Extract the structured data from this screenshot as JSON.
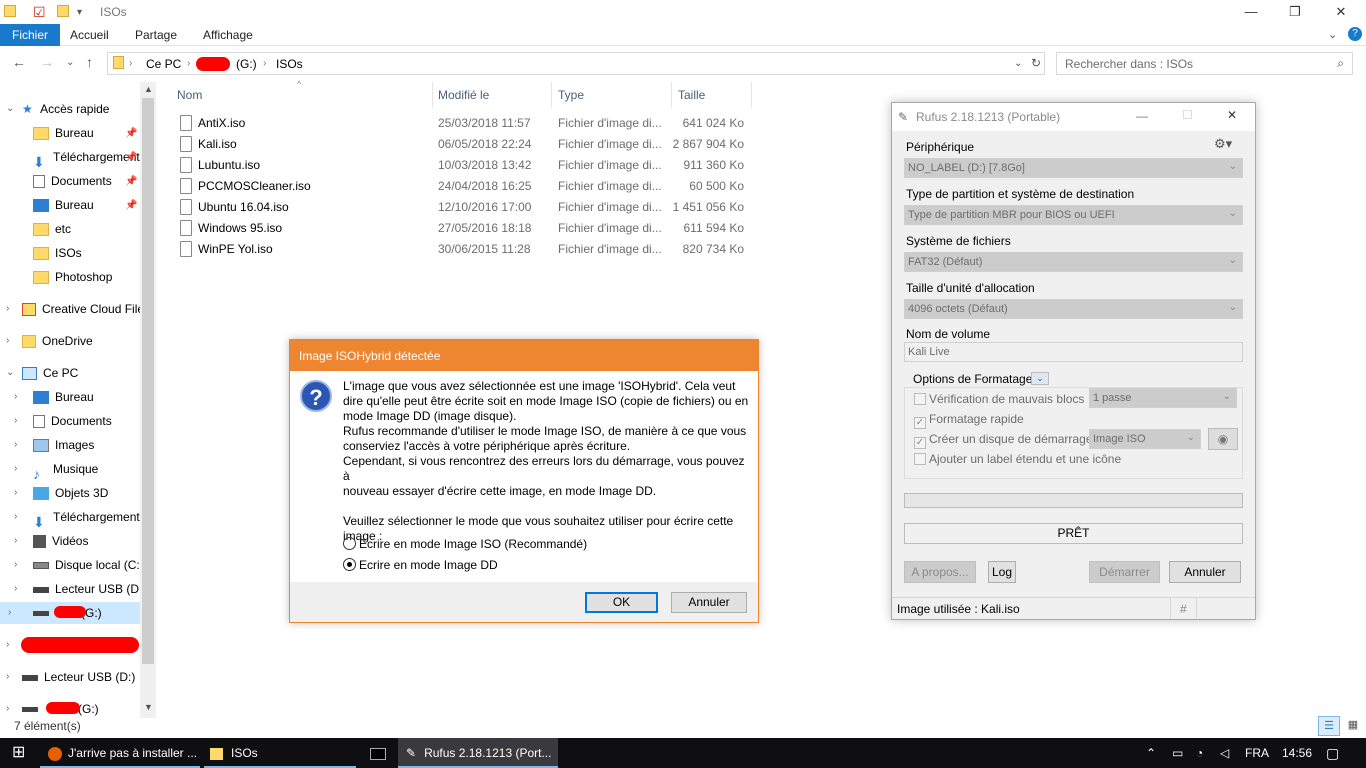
{
  "explorer": {
    "title": "ISOs",
    "ribbon_tabs": [
      "Fichier",
      "Accueil",
      "Partage",
      "Affichage"
    ],
    "breadcrumb": {
      "this_pc": "Ce PC",
      "drive": "(G:)",
      "folder": "ISOs"
    },
    "search_placeholder": "Rechercher dans : ISOs",
    "columns": {
      "name": "Nom",
      "modified": "Modifié le",
      "type": "Type",
      "size": "Taille"
    },
    "files": [
      {
        "name": "AntiX.iso",
        "modified": "25/03/2018 11:57",
        "type": "Fichier d'image di...",
        "size": "641 024 Ko"
      },
      {
        "name": "Kali.iso",
        "modified": "06/05/2018 22:24",
        "type": "Fichier d'image di...",
        "size": "2 867 904 Ko"
      },
      {
        "name": "Lubuntu.iso",
        "modified": "10/03/2018 13:42",
        "type": "Fichier d'image di...",
        "size": "911 360 Ko"
      },
      {
        "name": "PCCMOSCleaner.iso",
        "modified": "24/04/2018 16:25",
        "type": "Fichier d'image di...",
        "size": "60 500 Ko"
      },
      {
        "name": "Ubuntu 16.04.iso",
        "modified": "12/10/2016 17:00",
        "type": "Fichier d'image di...",
        "size": "1 451 056 Ko"
      },
      {
        "name": "Windows 95.iso",
        "modified": "27/05/2016 18:18",
        "type": "Fichier d'image di...",
        "size": "611 594 Ko"
      },
      {
        "name": "WinPE Yol.iso",
        "modified": "30/06/2015 11:28",
        "type": "Fichier d'image di...",
        "size": "820 734 Ko"
      }
    ],
    "nav": {
      "quick_access": "Accès rapide",
      "quick_items": [
        "Bureau",
        "Téléchargements",
        "Documents",
        "Bureau",
        "etc",
        "ISOs",
        "Photoshop"
      ],
      "creative_cloud": "Creative Cloud Files",
      "onedrive": "OneDrive",
      "this_pc": "Ce PC",
      "pc_items": [
        "Bureau",
        "Documents",
        "Images",
        "Musique",
        "Objets 3D",
        "Téléchargements",
        "Vidéos",
        "Disque local (C:)",
        "Lecteur USB (D:)",
        "(G:)"
      ],
      "usb_d": "Lecteur USB (D:)",
      "g_drive": "(G:)"
    },
    "status": "7 élément(s)"
  },
  "dialog": {
    "title": "Image ISOHybrid détectée",
    "message_lines": [
      "L'image que vous avez sélectionnée est une image 'ISOHybrid'. Cela veut",
      "dire qu'elle peut être écrite soit en mode Image ISO (copie de fichiers) ou en",
      "mode Image DD (image disque).",
      "Rufus recommande d'utiliser le mode Image ISO, de manière à ce que vous",
      "conserviez l'accès à votre périphérique après écriture.",
      "Cependant, si vous rencontrez des erreurs lors du démarrage, vous pouvez à",
      "nouveau essayer d'écrire cette image, en mode Image DD.",
      "",
      "Veuillez sélectionner le mode que vous souhaitez utiliser pour écrire cette",
      "image :"
    ],
    "option_iso": "Ecrire en mode Image ISO (Recommandé)",
    "option_dd": "Ecrire en mode Image DD",
    "ok": "OK",
    "cancel": "Annuler"
  },
  "rufus": {
    "title": "Rufus 2.18.1213 (Portable)",
    "device_label": "Périphérique",
    "device_value": "NO_LABEL (D:) [7.8Go]",
    "partition_label": "Type de partition et système de destination",
    "partition_value": "Type de partition MBR pour BIOS ou UEFI",
    "fs_label": "Système de fichiers",
    "fs_value": "FAT32 (Défaut)",
    "cluster_label": "Taille d'unité d'allocation",
    "cluster_value": "4096 octets (Défaut)",
    "volume_label": "Nom de volume",
    "volume_value": "Kali Live",
    "format_options": "Options de Formatage",
    "bad_blocks": "Vérification de mauvais blocs",
    "passes": "1 passe",
    "quick_format": "Formatage rapide",
    "bootable": "Créer un disque de démarrage",
    "boot_type": "Image ISO",
    "extended_label": "Ajouter un label étendu et une icône",
    "status": "PRÊT",
    "about": "A propos...",
    "log": "Log",
    "start": "Démarrer",
    "close": "Annuler",
    "statusbar": "Image utilisée : Kali.iso",
    "hash": "#"
  },
  "taskbar": {
    "firefox": "J'arrive pas à installer ...",
    "explorer": "ISOs",
    "rufus": "Rufus 2.18.1213 (Port...",
    "lang": "FRA",
    "time": "14:56"
  }
}
